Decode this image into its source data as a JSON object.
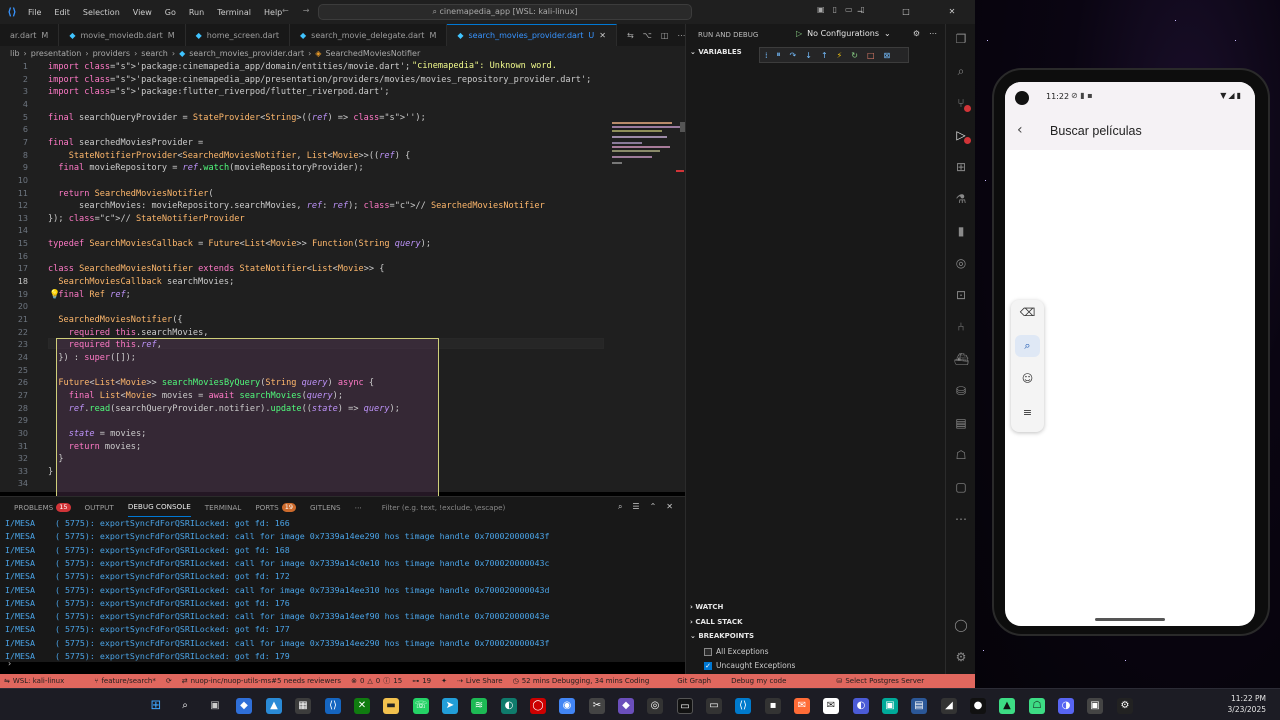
{
  "titlebar": {
    "menu": [
      "File",
      "Edit",
      "Selection",
      "View",
      "Go",
      "Run",
      "Terminal",
      "Help"
    ],
    "search": "cinemapedia_app [WSL: kali-linux]"
  },
  "tabs": [
    {
      "label": "ar.dart",
      "mod": "M",
      "active": false
    },
    {
      "label": "movie_moviedb.dart",
      "mod": "M",
      "active": false
    },
    {
      "label": "home_screen.dart",
      "mod": "",
      "active": false
    },
    {
      "label": "search_movie_delegate.dart",
      "mod": "M",
      "active": false
    },
    {
      "label": "search_movies_provider.dart",
      "mod": "U",
      "active": true
    }
  ],
  "breadcrumb": [
    "lib",
    "presentation",
    "providers",
    "search",
    "search_movies_provider.dart",
    "SearchedMoviesNotifier"
  ],
  "editor": {
    "diagnostic": "\"cinemapedia\": Unknown word.",
    "lines": [
      {
        "n": "1",
        "text": "import 'package:cinemapedia_app/domain/entities/movie.dart';"
      },
      {
        "n": "2",
        "text": "import 'package:cinemapedia_app/presentation/providers/movies/movies_repository_provider.dart';"
      },
      {
        "n": "3",
        "text": "import 'package:flutter_riverpod/flutter_riverpod.dart';"
      },
      {
        "n": "4",
        "text": ""
      },
      {
        "n": "5",
        "text": "final searchQueryProvider = StateProvider<String>((ref) => '');"
      },
      {
        "n": "6",
        "text": ""
      },
      {
        "n": "7",
        "text": "final searchedMoviesProvider ="
      },
      {
        "n": "8",
        "text": "    StateNotifierProvider<SearchedMoviesNotifier, List<Movie>>((ref) {"
      },
      {
        "n": "9",
        "text": "  final movieRepository = ref.watch(movieRepositoryProvider);"
      },
      {
        "n": "10",
        "text": ""
      },
      {
        "n": "11",
        "text": "  return SearchedMoviesNotifier("
      },
      {
        "n": "12",
        "text": "      searchMovies: movieRepository.searchMovies, ref: ref); // SearchedMoviesNotifier"
      },
      {
        "n": "13",
        "text": "}); // StateNotifierProvider"
      },
      {
        "n": "14",
        "text": ""
      },
      {
        "n": "15",
        "text": "typedef SearchMoviesCallback = Future<List<Movie>> Function(String query);"
      },
      {
        "n": "16",
        "text": ""
      },
      {
        "n": "17",
        "text": "class SearchedMoviesNotifier extends StateNotifier<List<Movie>> {"
      },
      {
        "n": "18",
        "text": "  SearchMoviesCallback searchMovies;"
      },
      {
        "n": "19",
        "text": "  final Ref ref;"
      },
      {
        "n": "20",
        "text": ""
      },
      {
        "n": "21",
        "text": "  SearchedMoviesNotifier({"
      },
      {
        "n": "22",
        "text": "    required this.searchMovies,"
      },
      {
        "n": "23",
        "text": "    required this.ref,"
      },
      {
        "n": "24",
        "text": "  }) : super([]);"
      },
      {
        "n": "25",
        "text": ""
      },
      {
        "n": "26",
        "text": "  Future<List<Movie>> searchMoviesByQuery(String query) async {"
      },
      {
        "n": "27",
        "text": "    final List<Movie> movies = await searchMovies(query);"
      },
      {
        "n": "28",
        "text": "    ref.read(searchQueryProvider.notifier).update((state) => query);"
      },
      {
        "n": "29",
        "text": ""
      },
      {
        "n": "30",
        "text": "    state = movies;"
      },
      {
        "n": "31",
        "text": "    return movies;"
      },
      {
        "n": "32",
        "text": "  }"
      },
      {
        "n": "33",
        "text": "}"
      },
      {
        "n": "34",
        "text": ""
      }
    ]
  },
  "panel": {
    "tabs": [
      {
        "label": "PROBLEMS",
        "badge": "15"
      },
      {
        "label": "OUTPUT",
        "badge": ""
      },
      {
        "label": "DEBUG CONSOLE",
        "badge": ""
      },
      {
        "label": "TERMINAL",
        "badge": ""
      },
      {
        "label": "PORTS",
        "badge": "19"
      },
      {
        "label": "GITLENS",
        "badge": ""
      }
    ],
    "filter_placeholder": "Filter (e.g. text, !exclude, \\escape)",
    "logs": [
      "I/MESA    ( 5775): exportSyncFdForQSRILocked: got fd: 166",
      "I/MESA    ( 5775): exportSyncFdForQSRILocked: call for image 0x7339a14ee290 hos timage handle 0x700020000043f",
      "I/MESA    ( 5775): exportSyncFdForQSRILocked: got fd: 168",
      "I/MESA    ( 5775): exportSyncFdForQSRILocked: call for image 0x7339a14c0e10 hos timage handle 0x700020000043c",
      "I/MESA    ( 5775): exportSyncFdForQSRILocked: got fd: 172",
      "I/MESA    ( 5775): exportSyncFdForQSRILocked: call for image 0x7339a14ee310 hos timage handle 0x700020000043d",
      "I/MESA    ( 5775): exportSyncFdForQSRILocked: got fd: 176",
      "I/MESA    ( 5775): exportSyncFdForQSRILocked: call for image 0x7339a14eef90 hos timage handle 0x700020000043e",
      "I/MESA    ( 5775): exportSyncFdForQSRILocked: got fd: 177",
      "I/MESA    ( 5775): exportSyncFdForQSRILocked: call for image 0x7339a14ee290 hos timage handle 0x700020000043f",
      "I/MESA    ( 5775): exportSyncFdForQSRILocked: got fd: 179"
    ]
  },
  "debug": {
    "title": "RUN AND DEBUG",
    "config": "No Configurations",
    "variables": "VARIABLES",
    "watch": "WATCH",
    "call_stack": "CALL STACK",
    "breakpoints": "BREAKPOINTS",
    "all_exceptions": "All Exceptions",
    "uncaught_exceptions": "Uncaught Exceptions"
  },
  "statusbar": {
    "remote": "WSL: kali-linux",
    "branch": "feature/search*",
    "pr": "nuop-inc/nuop-utils-ms#5 needs reviewers",
    "errors": "0",
    "warnings": "0",
    "issues": "15",
    "ports": "19",
    "live_share": "Live Share",
    "time_tracking": "52 mins Debugging, 34 mins Coding",
    "git_graph": "Git Graph",
    "debug_code": "Debug my code",
    "postgres": "Select Postgres Server"
  },
  "phone": {
    "time": "11:22",
    "title": "Buscar películas"
  },
  "taskbar": {
    "time": "11:22 PM",
    "date": "3/23/2025"
  },
  "colors": {
    "statusbar": "#e0675e",
    "accent": "#0078d4"
  }
}
